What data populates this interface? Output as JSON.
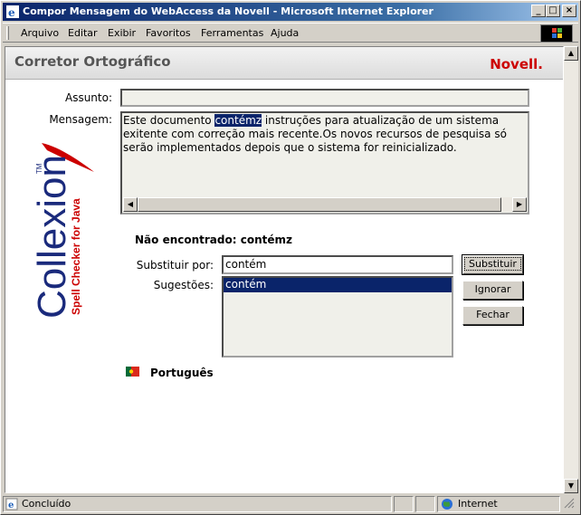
{
  "window": {
    "title": "Compor Mensagem do WebAccess da Novell - Microsoft Internet Explorer",
    "controls": {
      "minimize": "_",
      "maximize": "□",
      "close": "×"
    }
  },
  "menu": [
    "Arquivo",
    "Editar",
    "Exibir",
    "Favoritos",
    "Ferramentas",
    "Ajuda"
  ],
  "header": {
    "title": "Corretor Ortográfico",
    "brand": "Novell."
  },
  "form": {
    "subject_label": "Assunto:",
    "subject_value": "",
    "message_label": "Mensagem:",
    "message_before": "Este documento ",
    "message_highlight": "contémz",
    "message_after": " instruções para atualização de um sistema exitente com correção mais recente.Os novos recursos de pesquisa só serão implementados depois que o sistema for reinicializado."
  },
  "spell": {
    "not_found_label": "Não encontrado: contémz",
    "replace_label": "Substituir por:",
    "replace_value": "contém",
    "suggestions_label": "Sugestões:",
    "suggestions": [
      "contém"
    ],
    "buttons": {
      "replace": "Substituir",
      "ignore": "Ignorar",
      "close": "Fechar"
    },
    "language": "Português"
  },
  "logo": {
    "name": "Collexion",
    "tagline": "Spell Checker for Java",
    "tm": "TM"
  },
  "status": {
    "text": "Concluído",
    "zone": "Internet"
  },
  "colors": {
    "accent": "#0a246a",
    "brand": "#cc0000",
    "logo_blue": "#1a2a7c"
  }
}
